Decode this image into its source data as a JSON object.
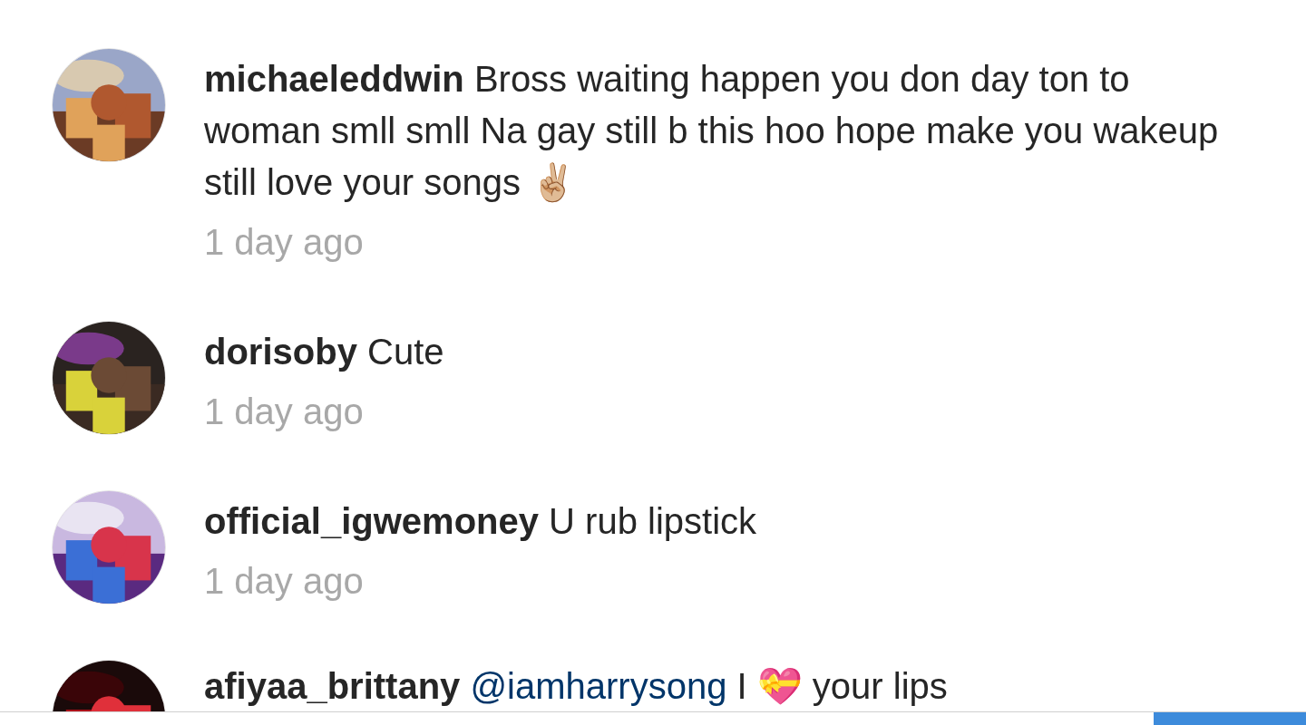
{
  "comments": [
    {
      "username": "michaeleddwin",
      "text": "Bross waiting happen you don day ton to woman smll smll Na gay still b this hoo hope make you wakeup still love your songs ✌🏼",
      "time": "1 day ago"
    },
    {
      "username": "dorisoby",
      "text": "Cute",
      "time": "1 day ago"
    },
    {
      "username": "official_igwemoney",
      "text": "U rub lipstick",
      "time": "1 day ago"
    },
    {
      "username": "afiyaa_brittany",
      "mention": "@iamharrysong",
      "text": "I 💝 your lips"
    }
  ]
}
